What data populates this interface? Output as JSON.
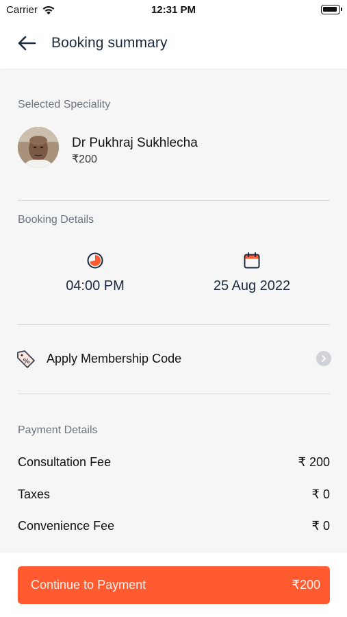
{
  "status_bar": {
    "carrier": "Carrier",
    "time": "12:31 PM"
  },
  "header": {
    "title": "Booking summary",
    "back_icon": "arrow-left-icon"
  },
  "speciality": {
    "label": "Selected Speciality",
    "doctor_name": "Dr Pukhraj Sukhlecha",
    "doctor_price": "₹200"
  },
  "booking": {
    "label": "Booking Details",
    "time": "04:00 PM",
    "date": "25 Aug 2022",
    "time_icon": "clock-icon",
    "date_icon": "calendar-icon"
  },
  "membership": {
    "label": "Apply Membership Code",
    "icon": "discount-tag-icon",
    "chevron": "chevron-right-icon"
  },
  "payment": {
    "label": "Payment Details",
    "rows": [
      {
        "label": "Consultation Fee",
        "value": "₹ 200"
      },
      {
        "label": "Taxes",
        "value": "₹ 0"
      },
      {
        "label": "Convenience Fee",
        "value": "₹ 0"
      }
    ]
  },
  "footer": {
    "button_label": "Continue to Payment",
    "amount": "₹200"
  },
  "colors": {
    "accent": "#ff5a30",
    "title": "#1c2a3f",
    "muted": "#6b7480",
    "background": "#f6f6f7"
  }
}
